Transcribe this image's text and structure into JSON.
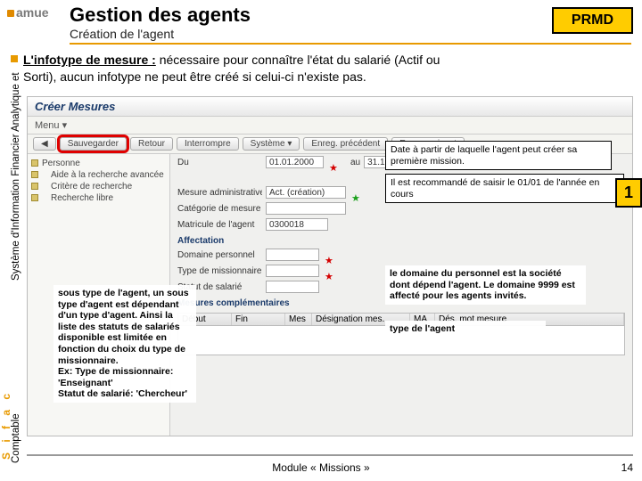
{
  "logo": "amue",
  "page_title": "Gestion des agents",
  "page_subtitle": "Création de l'agent",
  "prmd": "PRMD",
  "bullet_line1_a": "L'infotype de mesure :",
  "bullet_line1_b": " nécessaire pour connaître l'état du salarié (Actif ou",
  "bullet_line2": "Sorti), aucun infotype ne peut être créé si celui-ci n'existe pas.",
  "sidebar_long": "Système d'Information Financier Analytique et",
  "sidebar_sifac": "S i f a c",
  "sidebar_comptable": "Comptable",
  "sap": {
    "title": "Créer Mesures",
    "menu": "Menu ▾",
    "toolbar": {
      "back": "◀",
      "save": "Sauvegarder",
      "retour": "Retour",
      "interrompre": "Interrompre",
      "systeme": "Système ▾",
      "enreg_prec": "Enreg. précédent",
      "enreg_suiv": "Enreg. suivant"
    },
    "tree": {
      "root": "Personne",
      "item1": "Aide à la recherche avancée",
      "item2": "Critère de recherche",
      "item3": "Recherche libre"
    },
    "fields": {
      "du_label": "Du",
      "du_value": "01.01.2000",
      "au_label": "au",
      "au_value": "31.12.9999",
      "mesure_label": "Mesure administrative",
      "mesure_value": "Act. (création)",
      "categ_label": "Catégorie de mesure",
      "matricule_label": "Matricule de l'agent",
      "matricule_value": "0300018",
      "domaine_label": "Domaine personnel",
      "missionnaire_label": "Type de missionnaire",
      "salarie_label": "Statut de salarié"
    },
    "section2": "Affectation",
    "section3": "Mesures complémentaires",
    "grid": {
      "c1": "Début",
      "c2": "Fin",
      "c3": "Mes",
      "c4": "Désignation mes.",
      "c5": "MA",
      "c6": "Dés. mot mesure"
    }
  },
  "anno": {
    "date": "Date à partir de laquelle l'agent peut créer sa première mission.",
    "reco": "Il est recommandé de saisir le 01/01 de l'année en cours",
    "domaine": "le domaine du personnel est la société dont dépend l'agent. Le domaine 9999 est affecté pour les agents invités.",
    "type_agent": "type de l'agent",
    "left": "sous type de l'agent, un sous type d'agent est dépendant d'un type d'agent. Ainsi la liste des statuts de salariés disponible est limitée en fonction du choix du type de missionnaire.\nEx: Type de missionnaire: 'Enseignant'\n   Statut de salarié: 'Chercheur'"
  },
  "yellow_tag": "1",
  "footer": "Module « Missions »",
  "page_number": "14"
}
